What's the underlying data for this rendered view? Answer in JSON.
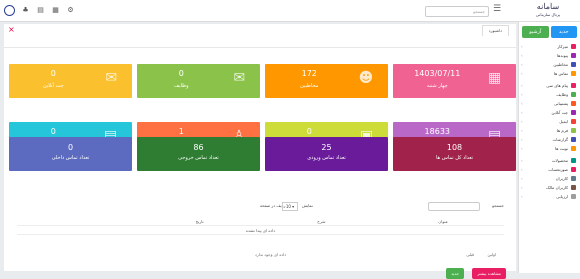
{
  "topbar": {
    "search_placeholder": "جستجو"
  },
  "logo": {
    "title": "سامانه",
    "subtitle": "پرتال سازمانی"
  },
  "sidebar": {
    "btn_new": "جدید",
    "btn_archive": "آرشیو",
    "items": [
      {
        "label": "میزکار",
        "color": "#e91e63"
      },
      {
        "label": "پیوندها",
        "color": "#9c27b0"
      },
      {
        "label": "مخاطبین",
        "color": "#3f51b5"
      },
      {
        "label": "تماس ها",
        "color": "#ff9800"
      },
      {
        "label": "پیام های سی",
        "color": "#e91e63"
      },
      {
        "label": "وظایف",
        "color": "#4caf50"
      },
      {
        "label": "پشتیبانی",
        "color": "#ff5722"
      },
      {
        "label": "چت آنلاین",
        "color": "#9c27b0"
      },
      {
        "label": "ایمیل",
        "color": "#f44336"
      },
      {
        "label": "فرم ها",
        "color": "#8bc34a"
      },
      {
        "label": "گزارشات",
        "color": "#3f51b5"
      },
      {
        "label": "نوبت ها",
        "color": "#ff9800"
      },
      {
        "label": "محصولات",
        "color": "#009688"
      },
      {
        "label": "صورتحساب",
        "color": "#e91e63"
      },
      {
        "label": "کاربران",
        "color": "#607d8b"
      },
      {
        "label": "کاربران مالک",
        "color": "#795548"
      },
      {
        "label": "ارزیابی",
        "color": "#9e9e9e"
      }
    ]
  },
  "main": {
    "tab_title": "داشبورد",
    "buttons": [
      {
        "label": "داشبورد",
        "bg": "#f44336"
      },
      {
        "label": "پیشنهاد",
        "bg": "#ffffff"
      },
      {
        "label": "پرونده ها",
        "bg": "#ffffff"
      }
    ],
    "cards_row1": [
      {
        "num": "0",
        "label": "چت آنلاین",
        "color": "#fbc02d",
        "icon": "chat-icon",
        "glyph": "✉"
      },
      {
        "num": "0",
        "label": "وظایف",
        "color": "#8bc34a",
        "icon": "tasks-icon",
        "glyph": "✉"
      },
      {
        "num": "172",
        "label": "مخاطبین",
        "color": "#ff9800",
        "icon": "contacts-icon",
        "glyph": "☻"
      },
      {
        "num": "1403/07/11",
        "label": "چهار شنبه",
        "color": "#f06292",
        "icon": "calendar-icon",
        "glyph": "▦"
      }
    ],
    "cards_row2": [
      {
        "num": "0",
        "label": "پیامک ارسالی",
        "color": "#26c6da",
        "icon": "sms-icon",
        "glyph": "▤"
      },
      {
        "num": "1",
        "label": "کاربران آنلاین",
        "color": "#ff7043",
        "icon": "user-icon",
        "glyph": "♙"
      },
      {
        "num": "0",
        "label": "فاکتورها",
        "color": "#cddc39",
        "icon": "invoice-icon",
        "glyph": "▣"
      },
      {
        "num": "18633",
        "label": "پیوندها",
        "color": "#ba68c8",
        "icon": "links-icon",
        "glyph": "▤"
      }
    ],
    "cards_row3": [
      {
        "num": "0",
        "label": "تعداد تماس داخلی",
        "color": "#5c6bc0"
      },
      {
        "num": "86",
        "label": "تعداد تماس خروجی",
        "color": "#2e7d32"
      },
      {
        "num": "25",
        "label": "تعداد تماس ورودی",
        "color": "#6a1b9a"
      },
      {
        "num": "108",
        "label": "تعداد کل تماس ها",
        "color": "#a1224a"
      }
    ],
    "table": {
      "search_label": "جستجو",
      "show_label": "نمایش",
      "per_page": "10",
      "per_page_suffix": "ردیف در صفحه",
      "columns": [
        "عنوان",
        "شرح",
        "تاریخ",
        ""
      ],
      "empty_text": "داده ای پیدا نشده",
      "pagination_first": "اولین",
      "pagination_prev": "قبلی",
      "info_text": "داده ای وجود ندارد"
    },
    "actions": [
      {
        "label": "مشاهده بیشتر",
        "bg": "#e91e63"
      },
      {
        "label": "جدید",
        "bg": "#4caf50"
      }
    ]
  }
}
